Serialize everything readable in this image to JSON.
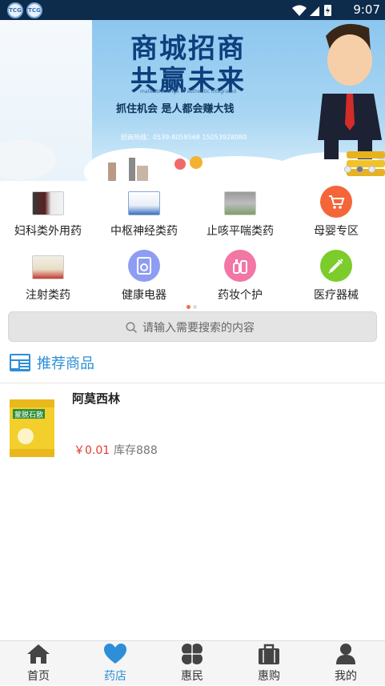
{
  "status_bar": {
    "time": "9:07",
    "app_icon_label": "TCG"
  },
  "banner": {
    "headline_line1": "商城招商",
    "headline_line2": "共赢未来",
    "tagline": "抓住机会 是人都会赚大钱",
    "small_text": "malleable range of authentic integrated",
    "hotline": "招商热线：0539-8058568  15053928080",
    "slide_count": 3,
    "active_slide": 1
  },
  "categories": [
    {
      "label": "妇科类外用药",
      "icon": "gynecology-medicine-icon"
    },
    {
      "label": "中枢神经类药",
      "icon": "nervous-system-medicine-icon"
    },
    {
      "label": "止咳平喘类药",
      "icon": "cough-medicine-icon"
    },
    {
      "label": "母婴专区",
      "icon": "mother-baby-cart-icon",
      "color": "#f4663a"
    },
    {
      "label": "注射类药",
      "icon": "injection-medicine-icon"
    },
    {
      "label": "健康电器",
      "icon": "health-appliance-icon",
      "color": "#8e9df2"
    },
    {
      "label": "药妆个护",
      "icon": "cosmetics-care-icon",
      "color": "#f277a4"
    },
    {
      "label": "医疗器械",
      "icon": "medical-device-syringe-icon",
      "color": "#7ccd2c"
    }
  ],
  "search": {
    "placeholder": "请输入需要搜索的内容"
  },
  "section": {
    "title": "推荐商品",
    "icon": "news-icon"
  },
  "products": [
    {
      "name": "阿莫西林",
      "price": "￥0.01",
      "stock": "库存888",
      "box_text": "蒙脱石散"
    }
  ],
  "nav": [
    {
      "label": "首页",
      "icon": "home-icon"
    },
    {
      "label": "药店",
      "icon": "heart-icon",
      "active": true
    },
    {
      "label": "惠民",
      "icon": "clover-icon"
    },
    {
      "label": "惠购",
      "icon": "bag-icon"
    },
    {
      "label": "我的",
      "icon": "user-icon"
    }
  ],
  "colors": {
    "accent": "#2c8fd8",
    "price": "#e23a2e",
    "status_bar": "#0d2b4a"
  }
}
